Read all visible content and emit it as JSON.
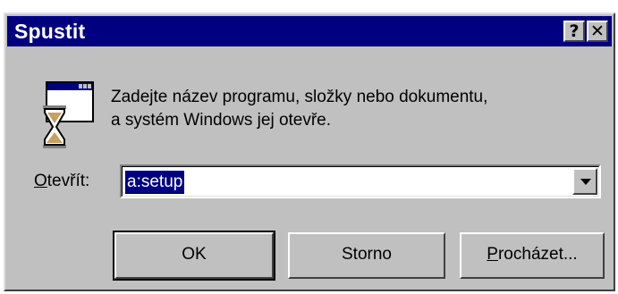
{
  "window": {
    "title": "Spustit"
  },
  "title_buttons": {
    "help": "?",
    "close": "✕"
  },
  "message": {
    "line1": "Zadejte název programu, složky nebo dokumentu,",
    "line2": "a systém Windows jej otevře."
  },
  "open_field": {
    "label_accel": "O",
    "label_rest": "tevřít:",
    "value": "a:setup"
  },
  "buttons": {
    "ok": "OK",
    "cancel": "Storno",
    "browse_accel": "P",
    "browse_rest": "rocházet..."
  },
  "icons": [
    "run-program-icon",
    "help-icon",
    "close-icon",
    "dropdown-arrow-icon"
  ],
  "colors": {
    "titlebar": "#000080",
    "face": "#c0c0c0",
    "selection": "#000080"
  }
}
